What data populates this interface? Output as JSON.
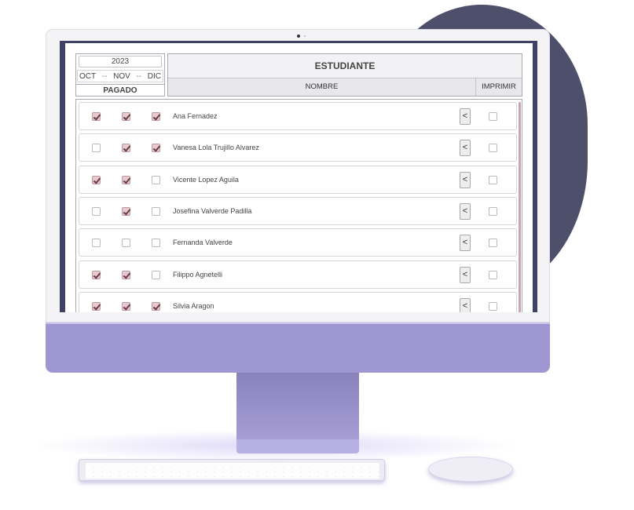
{
  "header": {
    "year": "2023",
    "months": [
      "OCT",
      "NOV",
      "DIC"
    ],
    "month_separator": "--",
    "paid_label": "PAGADO",
    "student_title": "ESTUDIANTE",
    "name_column": "NOMBRE",
    "print_column": "IMPRIMIR"
  },
  "rows": [
    {
      "name": "Ana Fernadez",
      "oct": true,
      "nov": true,
      "dic": true,
      "print": false
    },
    {
      "name": "Vanesa Lola Trujillo Alvarez",
      "oct": false,
      "nov": true,
      "dic": true,
      "print": false
    },
    {
      "name": "Vicente Lopez Aguila",
      "oct": true,
      "nov": true,
      "dic": false,
      "print": false
    },
    {
      "name": "Josefina Valverde Padilla",
      "oct": false,
      "nov": true,
      "dic": false,
      "print": false
    },
    {
      "name": "Fernanda Valverde",
      "oct": false,
      "nov": false,
      "dic": false,
      "print": false
    },
    {
      "name": "Filippo Agnetelli",
      "oct": true,
      "nov": true,
      "dic": false,
      "print": false
    },
    {
      "name": "Silvia Aragon",
      "oct": true,
      "nov": true,
      "dic": true,
      "print": false
    }
  ],
  "expand_button_label": "<",
  "colors": {
    "accent_check": "#e7c9cf",
    "screen_frame": "#3f4264",
    "monitor_chin": "#9f97d1",
    "background_blob": "#4d4f6b"
  },
  "icons": {
    "expand": "chevron-left-icon",
    "camera": "camera-icon"
  }
}
